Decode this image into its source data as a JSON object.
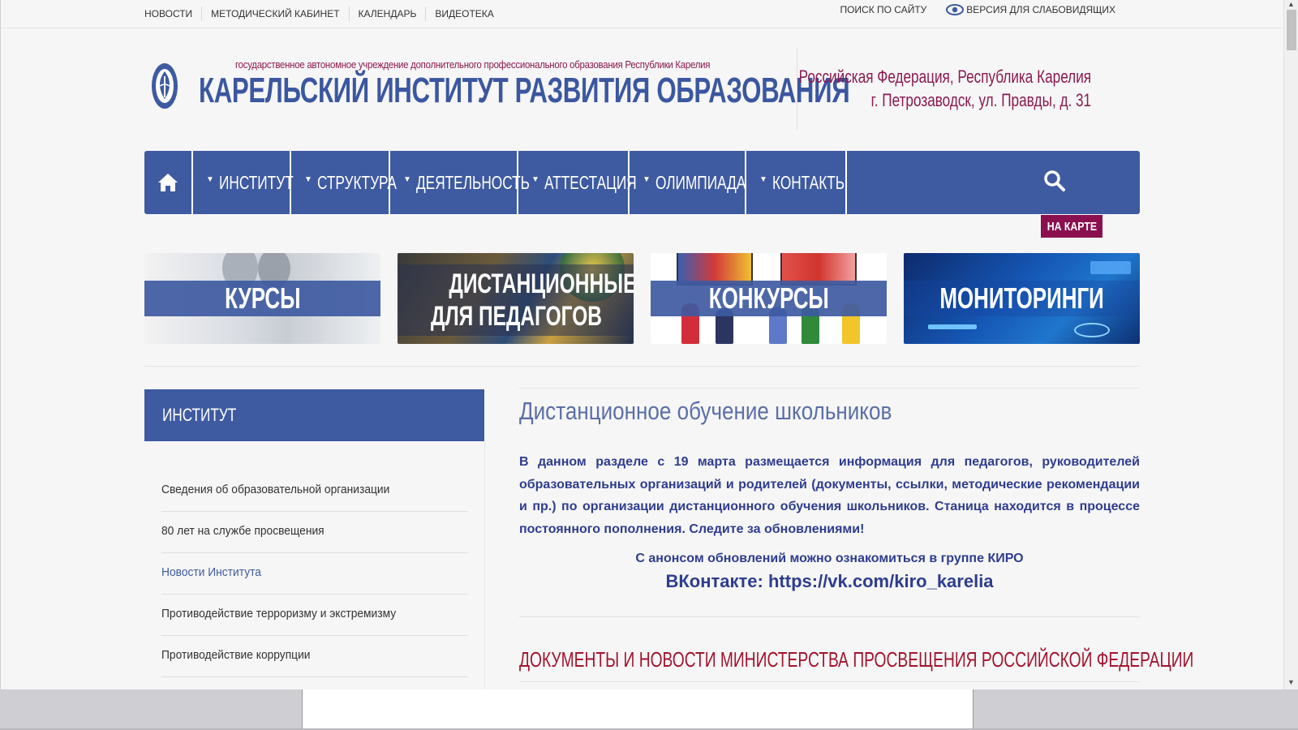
{
  "top_nav": {
    "items": [
      "НОВОСТИ",
      "МЕТОДИЧЕСКИЙ КАБИНЕТ",
      "КАЛЕНДАРЬ",
      "ВИДЕОТЕКА"
    ],
    "search_link": "ПОИСК ПО САЙТУ",
    "accessibility_link": "ВЕРСИЯ ДЛЯ СЛАБОВИДЯЩИХ"
  },
  "header": {
    "org_subtitle": "государственное автономное учреждение дополнительного профессионального образования Республики Карелия",
    "org_title": "КАРЕЛЬСКИЙ ИНСТИТУТ РАЗВИТИЯ ОБРАЗОВАНИЯ",
    "address_line1": "Российская Федерация, Республика Карелия",
    "address_line2": "г. Петрозаводск, ул. Правды, д. 31"
  },
  "main_nav": {
    "items": [
      "ИНСТИТУТ",
      "СТРУКТУРА",
      "ДЕЯТЕЛЬНОСТЬ",
      "АТТЕСТАЦИЯ",
      "ОЛИМПИАДА",
      "КОНТАКТЫ"
    ],
    "map_badge": "НА КАРТЕ"
  },
  "banners": {
    "courses": "КУРСЫ",
    "distance_line1": "ДИСТАНЦИОННЫЕ КУРСЫ",
    "distance_line2": "ДЛЯ ПЕДАГОГОВ",
    "contests": "КОНКУРСЫ",
    "monitoring": "МОНИТОРИНГИ"
  },
  "sidebar": {
    "heading": "ИНСТИТУТ",
    "items": [
      "Сведения об образовательной организации",
      "80 лет на службе просвещения",
      "Новости Института",
      "Противодействие терроризму и экстремизму",
      "Противодействие коррупции"
    ]
  },
  "content": {
    "title": "Дистанционное обучение школьников",
    "paragraph": "В данном разделе с 19 марта размещается информация для педагогов, руководителей образовательных организаций и родителей (документы, ссылки, методические рекомендации и пр.) по организации дистанционного обучения школьников. Станица находится в процессе постоянного пополнения. Следите за обновлениями!",
    "announce": "С анонсом обновлений можно ознакомиться в группе КИРО",
    "vk_label": "ВКонтакте:",
    "vk_link": "https://vk.com/kiro_karelia",
    "docs_title": "ДОКУМЕНТЫ И НОВОСТИ МИНИСТЕРСТВА ПРОСВЕЩЕНИЯ РОССИЙСКОЙ ФЕДЕРАЦИИ"
  },
  "colors": {
    "brand_blue": "#3e5aa1",
    "accent_maroon": "#8b1a4f",
    "docs_red": "#a3142e",
    "text_navy": "#2e3d8f"
  },
  "icons": [
    "home-icon",
    "search-icon",
    "eye-icon",
    "logo-emblem"
  ]
}
